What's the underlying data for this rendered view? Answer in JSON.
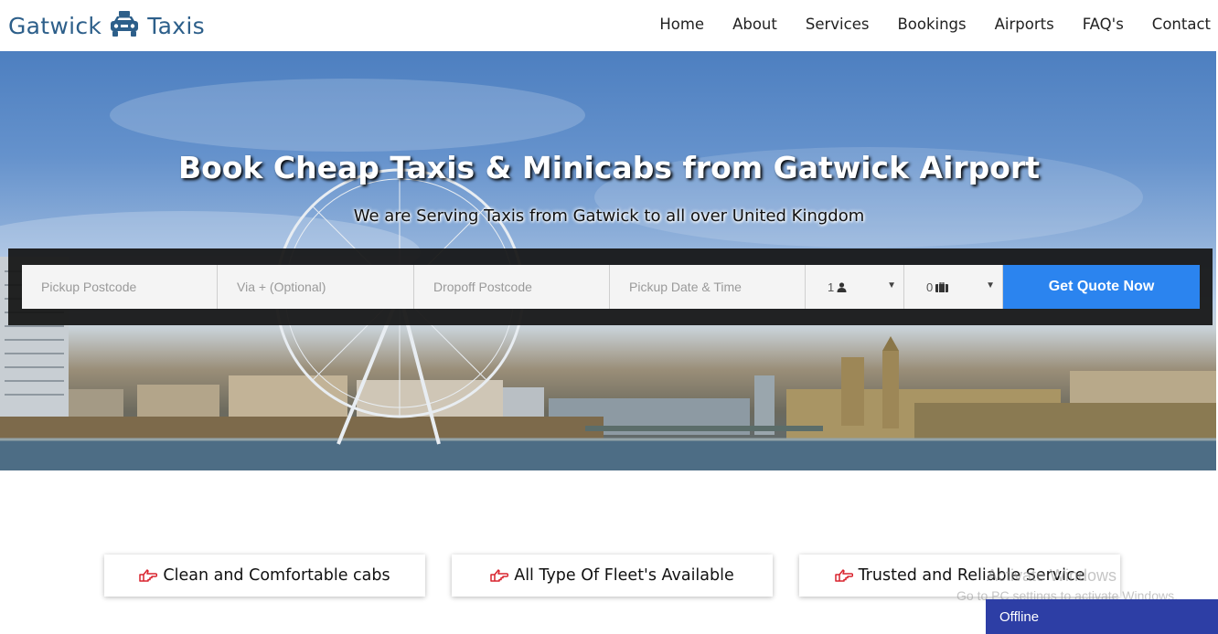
{
  "brand": {
    "left": "Gatwick",
    "right": "Taxis",
    "icon": "taxi-icon",
    "color": "#2d5f8a"
  },
  "nav": [
    "Home",
    "About",
    "Services",
    "Bookings",
    "Airports",
    "FAQ's",
    "Contact"
  ],
  "hero": {
    "title": "Book Cheap Taxis & Minicabs from Gatwick Airport",
    "subtitle": "We are Serving Taxis from Gatwick to all over United Kingdom"
  },
  "form": {
    "pickup_placeholder": "Pickup Postcode",
    "via_placeholder": "Via + (Optional)",
    "dropoff_placeholder": "Dropoff Postcode",
    "datetime_placeholder": "Pickup Date & Time",
    "passengers_value": "1",
    "passengers_icon": "user-icon",
    "luggage_value": "0",
    "luggage_icon": "suitcase-icon",
    "submit_label": "Get Quote Now",
    "accent": "#2b84ef"
  },
  "features": [
    {
      "label": "Clean and Comfortable cabs",
      "icon": "hand-point-right-icon"
    },
    {
      "label": "All Type Of Fleet's Available",
      "icon": "hand-point-right-icon"
    },
    {
      "label": "Trusted and Reliable Service",
      "icon": "hand-point-right-icon"
    }
  ],
  "watermark": {
    "line1": "Activate Windows",
    "line2": "Go to PC settings to activate Windows."
  },
  "chat": {
    "status": "Offline",
    "color": "#2d3ea5"
  }
}
